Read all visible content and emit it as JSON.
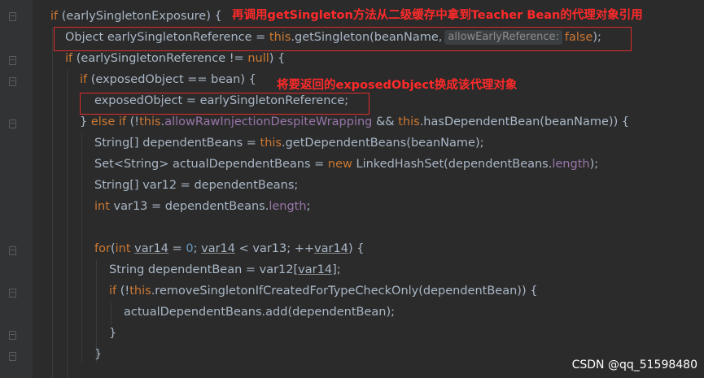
{
  "code": {
    "l1": {
      "kw": "if",
      "rest": " (earlySingletonExposure) {"
    },
    "l2": {
      "a": "Object earlySingletonReference = ",
      "this": "this",
      "b": ".getSingleton(beanName,",
      "hint": "allowEarlyReference:",
      "false": "false",
      "c": ");"
    },
    "l3": {
      "kw": "if",
      "a": " (earlySingletonReference != ",
      "null": "null",
      "b": ") {"
    },
    "l4": {
      "kw": "if",
      "rest": " (exposedObject == bean) {"
    },
    "l5": {
      "text": "exposedObject = earlySingletonReference;"
    },
    "l6": {
      "a": "} ",
      "else": "else",
      "sp": " ",
      "if": "if",
      "b": " (!",
      "this": "this",
      "dot": ".",
      "field": "allowRawInjectionDespiteWrapping",
      "c": " && ",
      "this2": "this",
      "d": ".hasDependentBean(beanName)) {"
    },
    "l7": {
      "a": "String[] dependentBeans = ",
      "this": "this",
      "b": ".getDependentBeans(beanName);"
    },
    "l8": {
      "a": "Set<String> actualDependentBeans = ",
      "new": "new",
      "b": " LinkedHashSet(dependentBeans.",
      "field": "length",
      "c": ");"
    },
    "l9": {
      "text": "String[] var12 = dependentBeans;"
    },
    "l10": {
      "int": "int",
      "a": " var13 = dependentBeans.",
      "field": "length",
      "b": ";"
    },
    "l11": {
      "for": "for",
      "a": "(",
      "int": "int",
      "sp": " ",
      "v1": "var14",
      "b": " = ",
      "zero": "0",
      "c": "; ",
      "v2": "var14",
      "d": " < var13; ++",
      "v3": "var14",
      "e": ") {"
    },
    "l12": {
      "a": "String dependentBean = var12[",
      "v": "var14",
      "b": "];"
    },
    "l13": {
      "if": "if",
      "a": " (!",
      "this": "this",
      "b": ".removeSingletonIfCreatedForTypeCheckOnly(dependentBean)) {"
    },
    "l14": {
      "text": "actualDependentBeans.add(dependentBean);"
    },
    "l15": {
      "text": "}"
    },
    "l16": {
      "text": "}"
    }
  },
  "annotations": {
    "top": "再调用getSingleton方法从二级缓存中拿到Teacher Bean的代理对象引用",
    "mid": "将要返回的exposedObject换成该代理对象"
  },
  "watermark": "CSDN @qq_51598480",
  "colors": {
    "background": "#2b2b2b",
    "keyword": "#cc7832",
    "text": "#a9b7c6",
    "field": "#9876aa",
    "number": "#6897bb",
    "annotation": "#ff2a2a"
  }
}
